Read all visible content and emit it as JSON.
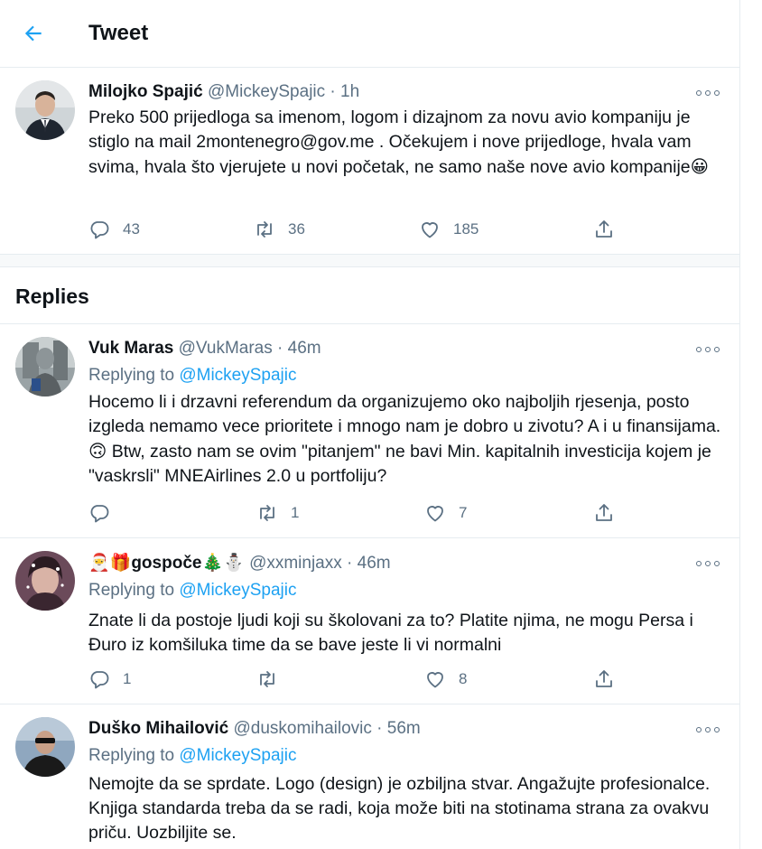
{
  "header": {
    "title": "Tweet"
  },
  "main_tweet": {
    "name": "Milojko Spajić",
    "handle": "@MickeySpajic",
    "time": "· 1h",
    "text": "Preko 500 prijedloga sa imenom, logom i dizajnom za novu avio kompaniju je stiglo na mail 2montenegro@gov.me . Očekujem i nove prijedloge, hvala vam svima, hvala što vjerujete u novi početak, ne samo naše nove avio kompanije",
    "emoji": "😀",
    "replies": "43",
    "retweets": "36",
    "likes": "185"
  },
  "replies_heading": "Replies",
  "replies": [
    {
      "name": "Vuk Maras",
      "handle": "@VukMaras",
      "time": "· 46m",
      "replying_prefix": "Replying to",
      "replying_handle": "@MickeySpajic",
      "text_before": "Hocemo li i drzavni referendum da organizujemo oko najboljih rjesenja, posto izgleda nemamo vece prioritete i mnogo nam je dobro u zivotu? A i u finansijama.",
      "emoji": "🙃",
      "text_after": " Btw, zasto nam se ovim \"pitanjem\" ne bavi Min. kapitalnih investicija kojem je \"vaskrsli\" MNEAirlines 2.0 u portfoliju?",
      "replies": "",
      "retweets": "1",
      "likes": "7"
    },
    {
      "name": "gospoče",
      "name_emoji_before": "🎅🎁",
      "name_emoji_after": "🎄⛄",
      "handle": "@xxminjaxx",
      "time": "· 46m",
      "replying_prefix": "Replying to",
      "replying_handle": "@MickeySpajic",
      "text": "Znate li da postoje ljudi koji su školovani za to? Platite njima, ne mogu Persa i Đuro iz komšiluka time da se bave jeste li vi normalni",
      "replies": "1",
      "retweets": "",
      "likes": "8"
    },
    {
      "name": "Duško Mihailović",
      "handle": "@duskomihailovic",
      "time": "· 56m",
      "replying_prefix": "Replying to",
      "replying_handle": "@MickeySpajic",
      "text": "Nemojte da se sprdate.  Logo (design) je ozbiljna stvar. Angažujte profesionalce. Knjiga standarda treba da se radi, koja može biti na stotinama strana za ovakvu priču. Uozbiljite se."
    }
  ],
  "colors": {
    "accent": "#1da1f2",
    "muted": "#5b7083",
    "divider": "#e6ecf0"
  },
  "icons": [
    "back-arrow-icon",
    "more-icon",
    "reply-icon",
    "retweet-icon",
    "like-icon",
    "share-icon"
  ]
}
